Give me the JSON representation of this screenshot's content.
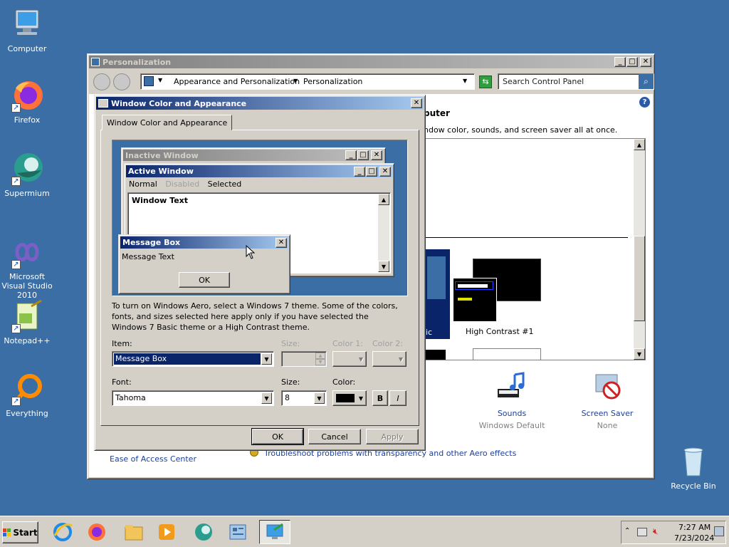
{
  "desktop": {
    "icons": [
      {
        "label": "Computer",
        "icon": "computer-icon"
      },
      {
        "label": "Firefox",
        "icon": "firefox-icon"
      },
      {
        "label": "Supermium",
        "icon": "supermium-icon"
      },
      {
        "label": "Microsoft Visual Studio 2010",
        "icon": "visual-studio-icon"
      },
      {
        "label": "Notepad++",
        "icon": "notepadpp-icon"
      },
      {
        "label": "Everything",
        "icon": "everything-icon"
      },
      {
        "label": "Recycle Bin",
        "icon": "recycle-bin-icon"
      }
    ]
  },
  "personalization": {
    "title": "Personalization",
    "breadcrumb": [
      "Appearance and Personalization",
      "Personalization"
    ],
    "search_placeholder": "Search Control Panel",
    "heading_fragment": "puter",
    "subtext_fragment": "ndow color, sounds, and screen saver all at once.",
    "theme_label_fragment": "ic",
    "theme_high_contrast": "High Contrast #1",
    "sounds_label": "Sounds",
    "sounds_value": "Windows Default",
    "screensaver_label": "Screen Saver",
    "screensaver_value": "None",
    "ease_link": "Ease of Access Center",
    "troubleshoot_link": "Troubleshoot problems with transparency and other Aero effects"
  },
  "dialog": {
    "title": "Window Color and Appearance",
    "tab": "Window Color and Appearance",
    "preview": {
      "inactive_title": "Inactive Window",
      "active_title": "Active Window",
      "menu_normal": "Normal",
      "menu_disabled": "Disabled",
      "menu_selected": "Selected",
      "window_text": "Window Text",
      "msgbox_title": "Message Box",
      "msgbox_text": "Message Text",
      "msgbox_ok": "OK"
    },
    "info_text": "To turn on Windows Aero, select a Windows 7 theme.  Some of the colors, fonts, and sizes selected here apply only if you have selected the Windows 7 Basic theme or a High Contrast theme.",
    "item_label": "Item:",
    "item_value": "Message Box",
    "size_label": "Size:",
    "color1_label": "Color 1:",
    "color2_label": "Color 2:",
    "font_label": "Font:",
    "font_value": "Tahoma",
    "font_size_label": "Size:",
    "font_size_value": "8",
    "font_color_label": "Color:",
    "bold_label": "B",
    "italic_label": "I",
    "ok": "OK",
    "cancel": "Cancel",
    "apply": "Apply",
    "font_color": "#000000"
  },
  "taskbar": {
    "start_label": "Start",
    "time": "7:27 AM",
    "date": "7/23/2024"
  },
  "colors": {
    "desktop": "#3a6ea5",
    "active_title_start": "#0a246a",
    "active_title_end": "#a6caf0",
    "selection": "#0a246a"
  }
}
